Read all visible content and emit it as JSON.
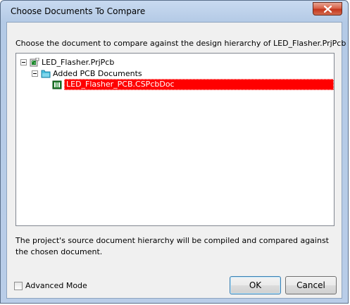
{
  "window": {
    "title": "Choose Documents To Compare"
  },
  "prompt": "Choose the document to compare against the design hierarchy of LED_Flasher.PrjPcb",
  "tree": {
    "project": {
      "label": "LED_Flasher.PrjPcb",
      "icon": "project-icon"
    },
    "folder": {
      "label": "Added PCB Documents",
      "icon": "folder-icon"
    },
    "document": {
      "label": "LED_Flasher_PCB.CSPcbDoc",
      "icon": "pcb-document-icon",
      "selected": true
    }
  },
  "info_text": "The project's source document hierarchy will be compiled and compared against the chosen document.",
  "advanced_mode": {
    "label": "Advanced Mode",
    "checked": false
  },
  "buttons": {
    "ok": "OK",
    "cancel": "Cancel"
  },
  "colors": {
    "selection": "#ff0000",
    "close_button": "#c4361d",
    "folder": "#2aa7c9"
  }
}
